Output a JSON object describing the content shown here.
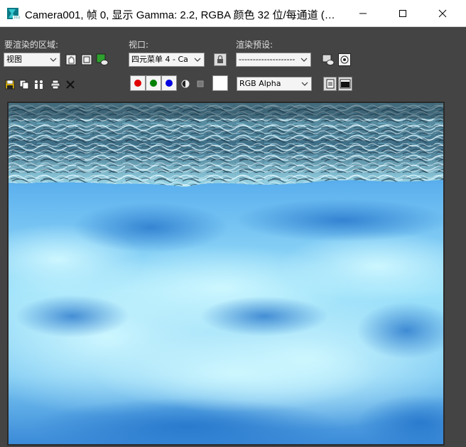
{
  "window": {
    "title": "Camera001, 帧 0, 显示 Gamma: 2.2, RGBA 颜色 32 位/每通道 (…"
  },
  "toolbar": {
    "area_label": "要渲染的区域:",
    "area_value": "视图",
    "viewport_label": "视口:",
    "viewport_value": "四元菜单 4 - Ca",
    "preset_label": "渲染预设:",
    "preset_value": "--------------------",
    "channel_value": "RGB Alpha"
  },
  "colors": {
    "red_channel": "#e00000",
    "green_channel": "#008000",
    "blue_channel": "#0000e0",
    "toolbar_bg": "#444444"
  },
  "icons": {
    "app": "3dsmax-icon",
    "minimize": "minimize-icon",
    "maximize": "maximize-icon",
    "close": "close-icon"
  }
}
